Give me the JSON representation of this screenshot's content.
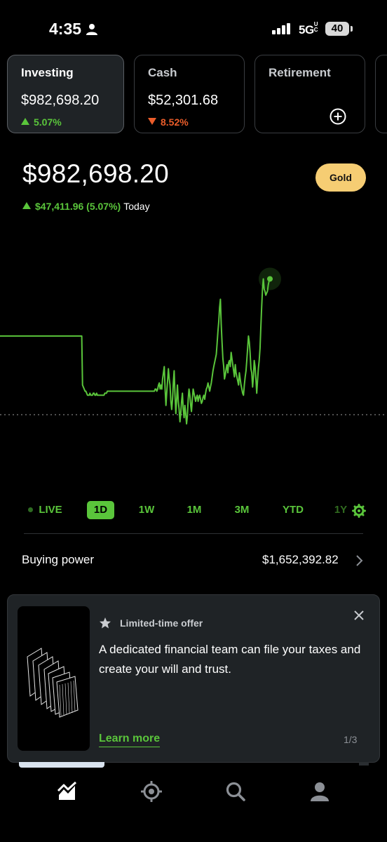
{
  "status_bar": {
    "time": "4:35",
    "network": "5G",
    "network_suffix": "UC",
    "battery": "40"
  },
  "accounts": [
    {
      "title": "Investing",
      "value": "$982,698.20",
      "change": "5.07%",
      "direction": "up",
      "active": true
    },
    {
      "title": "Cash",
      "value": "$52,301.68",
      "change": "8.52%",
      "direction": "down",
      "active": false
    },
    {
      "title": "Retirement",
      "action_icon": "add-circle-icon",
      "active": false
    }
  ],
  "portfolio": {
    "value": "$982,698.20",
    "gold_label": "Gold",
    "today_change": "$47,411.96 (5.07%)",
    "today_label": "Today"
  },
  "chart_data": {
    "type": "line",
    "title": "",
    "xlabel": "",
    "ylabel": "",
    "series_color": "#5ac53b",
    "reference_line": "previous close (dotted)",
    "series": [
      {
        "values": [
          76,
          76,
          76,
          76,
          76,
          76,
          76,
          76,
          76,
          76,
          76,
          76,
          76,
          76,
          76,
          76,
          76,
          76,
          76,
          76,
          76,
          76,
          76,
          76,
          76,
          76,
          76,
          76,
          76,
          76,
          76,
          76,
          76,
          76,
          76,
          76,
          76,
          76,
          76,
          76,
          76,
          76,
          76,
          76,
          76,
          76,
          76,
          76,
          76,
          76,
          76,
          76,
          76,
          76,
          76,
          76,
          76,
          76,
          76,
          76,
          76,
          76,
          76,
          76,
          76,
          76,
          76,
          76,
          76,
          76,
          76,
          76,
          76,
          76,
          76,
          76,
          76,
          76,
          76,
          76,
          76,
          76,
          76,
          76,
          76,
          76,
          76,
          76,
          76,
          76,
          76,
          76,
          76,
          76,
          76,
          76,
          76,
          76,
          76,
          76,
          52,
          51,
          50,
          49,
          49,
          48,
          47,
          47,
          47,
          48,
          47,
          47,
          47,
          48,
          48,
          47,
          47,
          48,
          47,
          47,
          47,
          47,
          47,
          47,
          47,
          47,
          47,
          48,
          48,
          48,
          49,
          49,
          49,
          49,
          49,
          49,
          49,
          49,
          49,
          49,
          49,
          49,
          49,
          49,
          49,
          49,
          49,
          49,
          49,
          49,
          49,
          49,
          49,
          49,
          49,
          49,
          49,
          49,
          49,
          49,
          49,
          49,
          49,
          49,
          49,
          49,
          49,
          49,
          49,
          49,
          49,
          49,
          49,
          49,
          49,
          49,
          49,
          49,
          49,
          49,
          49,
          49,
          49,
          49,
          49,
          49,
          49,
          49,
          50,
          50,
          49,
          50,
          52,
          53,
          50,
          52,
          50,
          55,
          58,
          61,
          50,
          42,
          48,
          54,
          60,
          55,
          52,
          44,
          40,
          45,
          53,
          59,
          47,
          38,
          45,
          52,
          44,
          40,
          34,
          38,
          44,
          48,
          40,
          36,
          42,
          38,
          33,
          37,
          45,
          50,
          47,
          42,
          39,
          45,
          50,
          48,
          46,
          44,
          46,
          47,
          44,
          46,
          47,
          45,
          43,
          44,
          46,
          47,
          45,
          48,
          50,
          51,
          53,
          51,
          49,
          51,
          53,
          56,
          59,
          61,
          63,
          65,
          67,
          72,
          78,
          83,
          90,
          94,
          82,
          73,
          65,
          61,
          55,
          57,
          60,
          62,
          58,
          63,
          64,
          61,
          68,
          65,
          62,
          59,
          56,
          62,
          58,
          56,
          54,
          52,
          58,
          55,
          52,
          50,
          48,
          47,
          52,
          56,
          59,
          64,
          70,
          76,
          73,
          68,
          60,
          58,
          51,
          56,
          64,
          61,
          55,
          48,
          54,
          60,
          64,
          70,
          80,
          90,
          99,
          104,
          99,
          98,
          96,
          97,
          98,
          101,
          103,
          104
        ]
      }
    ]
  },
  "ranges": {
    "live": "LIVE",
    "items": [
      "1D",
      "1W",
      "1M",
      "3M",
      "YTD",
      "1Y"
    ],
    "selected": "1D"
  },
  "buying_power": {
    "label": "Buying power",
    "value": "$1,652,392.82"
  },
  "offer": {
    "tag": "Limited-time offer",
    "body": "A dedicated financial team can file your taxes and create your will and trust.",
    "link": "Learn more",
    "page": "1/3"
  },
  "tabbar": [
    "portfolio-chart-icon",
    "crypto-icon",
    "search-icon",
    "profile-icon"
  ]
}
